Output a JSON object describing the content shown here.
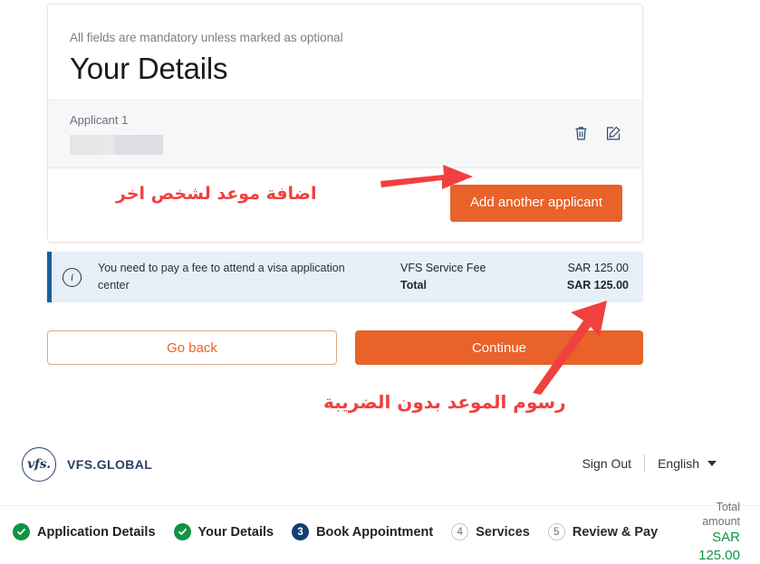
{
  "card": {
    "mandatory_note": "All fields are mandatory unless marked as optional",
    "title": "Your Details",
    "applicant": {
      "label": "Applicant 1",
      "name_redacted": "",
      "delete_icon": "trash-icon",
      "edit_icon": "edit-pencil-icon"
    },
    "add_applicant_label": "Add another applicant"
  },
  "fee_banner": {
    "info_icon": "info-circle-icon",
    "message": "You need to pay a fee to attend a visa application center",
    "rows": [
      {
        "label": "VFS Service Fee",
        "value": "SAR 125.00"
      },
      {
        "label": "Total",
        "value": "SAR 125.00"
      }
    ]
  },
  "actions": {
    "go_back_label": "Go back",
    "continue_label": "Continue"
  },
  "annotations": {
    "add_applicant_note": "اضافة موعد لشخص اخر",
    "fee_note": "رسوم الموعد بدون الضريبة"
  },
  "footer": {
    "logo_mark": "vfs.",
    "logo_text": "VFS.GLOBAL",
    "sign_out_label": "Sign Out",
    "language_value": "English",
    "language_caret_icon": "chevron-down-icon"
  },
  "stepper": {
    "steps": [
      {
        "marker": "✓",
        "label": "Application Details",
        "state": "done"
      },
      {
        "marker": "✓",
        "label": "Your Details",
        "state": "done"
      },
      {
        "marker": "3",
        "label": "Book Appointment",
        "state": "current"
      },
      {
        "marker": "4",
        "label": "Services",
        "state": "pending"
      },
      {
        "marker": "5",
        "label": "Review & Pay",
        "state": "pending"
      }
    ],
    "total_amount_label": "Total amount",
    "total_amount_value": "SAR 125.00"
  },
  "colors": {
    "accent_orange": "#e8622a",
    "annotation_red": "#f0403f",
    "banner_blue": "#1b5f9e",
    "brand_navy": "#2a3f66",
    "success_green": "#119342"
  }
}
